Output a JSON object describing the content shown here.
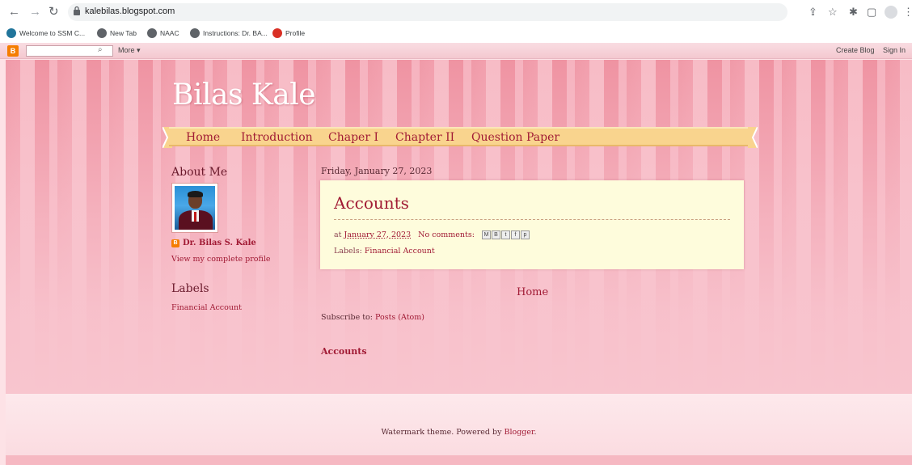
{
  "browser": {
    "url": "kalebilas.blogspot.com",
    "bookmarks": [
      "Welcome to SSM C...",
      "New Tab",
      "NAAC",
      "Instructions: Dr. BA...",
      "Profile"
    ]
  },
  "navbar": {
    "more_label": "More ▾",
    "create_blog": "Create Blog",
    "sign_in": "Sign In"
  },
  "blog": {
    "title": "Bilas Kale",
    "tabs": [
      "Home",
      "Introduction",
      "Chaper I",
      "Chapter II",
      "Question Paper"
    ]
  },
  "sidebar": {
    "about_heading": "About Me",
    "profile_name": "Dr. Bilas S. Kale",
    "profile_link": "View my complete profile",
    "labels_heading": "Labels",
    "labels": [
      "Financial Account"
    ]
  },
  "main": {
    "date": "Friday, January 27, 2023",
    "post": {
      "title": "Accounts",
      "at_prefix": "at",
      "time": "January 27, 2023",
      "comments": "No comments:",
      "labels_prefix": "Labels:",
      "label": "Financial Account",
      "share_icons": [
        "M",
        "B",
        "t",
        "f",
        "p"
      ]
    },
    "home_link": "Home",
    "subscribe_prefix": "Subscribe to:",
    "subscribe_link": "Posts (Atom)",
    "accounts_link": "Accounts"
  },
  "footer": {
    "text_prefix": "Watermark theme. Powered by",
    "blogger_link": "Blogger",
    "text_suffix": "."
  },
  "colors": {
    "accent": "#a11b35",
    "tab_band": "#f9d48e",
    "post_bg": "#fefcdc",
    "stripe_dark": "#f09aa8",
    "stripe_light": "#f7bcc6"
  }
}
